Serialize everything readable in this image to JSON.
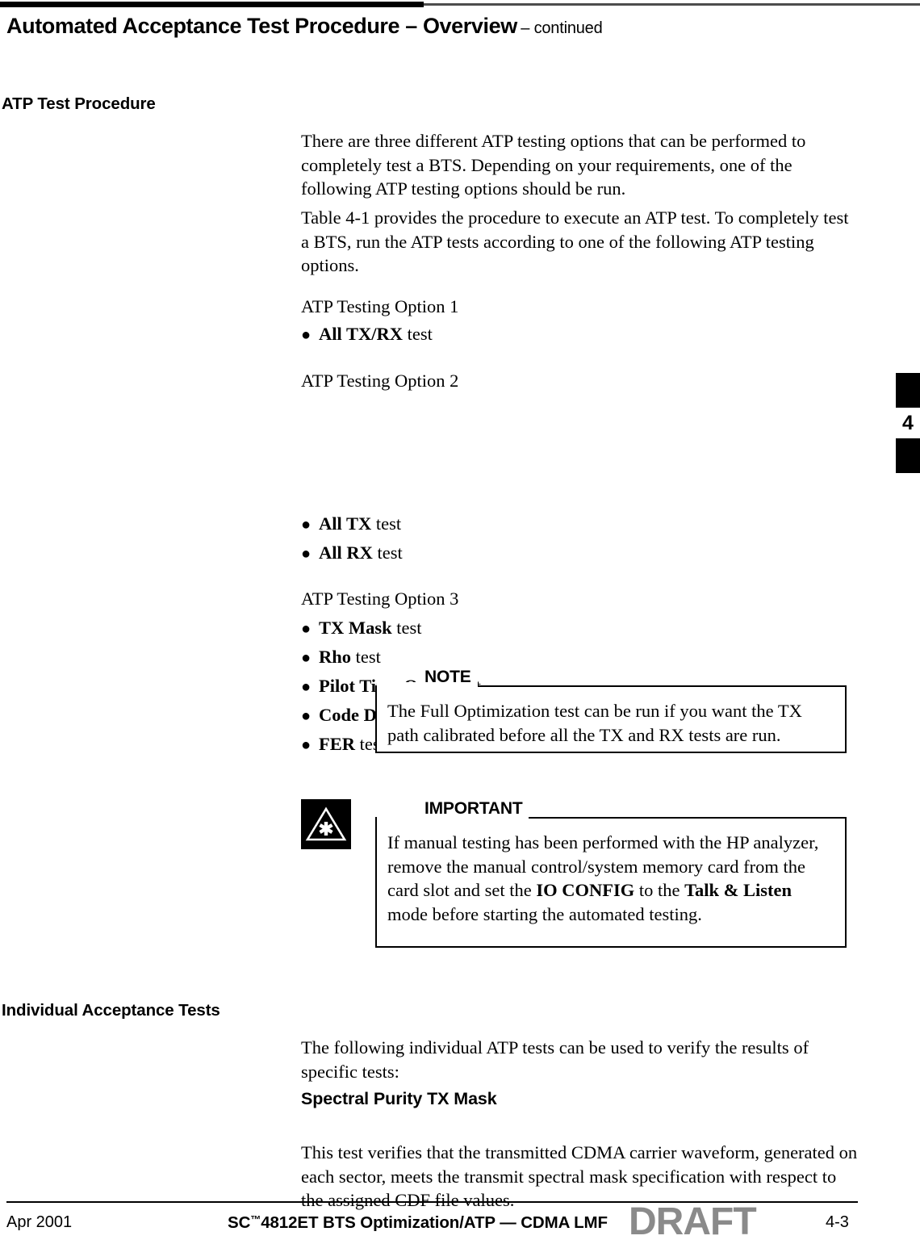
{
  "page": {
    "running_head_main": "Automated Acceptance Test Procedure – Overview",
    "running_head_continued": "– continued",
    "chapter_tab_number": "4"
  },
  "sections": {
    "atp_test_procedure": {
      "side_head": "ATP Test Procedure",
      "paragraph_1": "There are three different ATP testing options that can be performed to completely test a BTS. Depending on your requirements, one of the following ATP testing options should be run.",
      "paragraph_2": "Table 4-1 provides the procedure to execute an ATP test. To completely test a BTS, run the ATP tests according to one of the following ATP testing options.",
      "options": [
        {
          "title": "ATP Testing Option 1",
          "items": [
            {
              "bold": "All TX/RX",
              "rest": " test"
            }
          ]
        },
        {
          "title": "ATP Testing Option 2",
          "items": [
            {
              "bold": "All TX",
              "rest": " test"
            },
            {
              "bold": "All RX",
              "rest": " test"
            }
          ]
        },
        {
          "title": "ATP Testing Option 3",
          "items": [
            {
              "bold": "TX Mask",
              "rest": " test"
            },
            {
              "bold": "Rho",
              "rest": " test"
            },
            {
              "bold": "Pilot Time Offset",
              "rest": " test"
            },
            {
              "bold": "Code Domain Power",
              "rest": " test"
            },
            {
              "bold": "FER",
              "rest": " test"
            }
          ]
        }
      ]
    },
    "note": {
      "label": "NOTE",
      "text": "The Full Optimization test can be run if you want the TX path calibrated before all the TX and RX tests are run."
    },
    "important": {
      "label": "IMPORTANT",
      "icon": "asterisk-triangle-icon",
      "text_part_1": "If manual testing has been performed with the HP analyzer, remove the manual control/system memory card from the card slot and set the ",
      "text_bold_1": "IO CONFIG",
      "text_part_2": " to the ",
      "text_bold_2": "Talk & Listen",
      "text_part_3": " mode before starting the automated testing."
    },
    "individual_acceptance_tests": {
      "side_head": "Individual Acceptance Tests",
      "paragraph_1": "The following individual ATP tests can be used to verify the results of specific tests:",
      "sub_head": "Spectral Purity TX Mask",
      "paragraph_2": "This test verifies that the transmitted CDMA carrier waveform, generated on each sector, meets the transmit spectral mask specification with respect to the assigned CDF file values."
    }
  },
  "footer": {
    "date": "Apr 2001",
    "title_prefix": "SC",
    "title_tm": "™",
    "title_suffix": "4812ET BTS Optimization/ATP — CDMA LMF",
    "draft_watermark": "DRAFT",
    "page_number": "4-3"
  },
  "colors": {
    "text": "#000000",
    "rule_gray": "#4d4d4d",
    "draft_gray": "#8a8a8a"
  }
}
